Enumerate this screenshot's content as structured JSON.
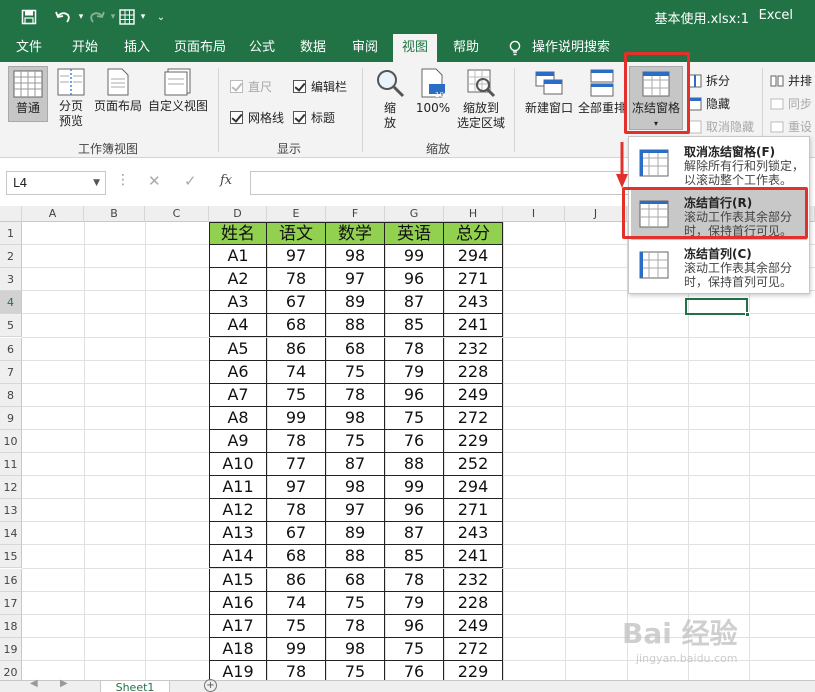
{
  "window": {
    "title": "基本使用.xlsx:1",
    "app_name": "Excel"
  },
  "menu": {
    "tabs": [
      "文件",
      "开始",
      "插入",
      "页面布局",
      "公式",
      "数据",
      "审阅",
      "视图",
      "帮助"
    ],
    "active_tab": "视图",
    "tell_me": "操作说明搜索"
  },
  "ribbon": {
    "workbook_views": {
      "label": "工作簿视图",
      "normal": "普通",
      "page_break_1": "分页",
      "page_break_2": "预览",
      "page_layout": "页面布局",
      "custom_views": "自定义视图"
    },
    "show": {
      "label": "显示",
      "ruler": "直尺",
      "formula_bar": "编辑栏",
      "gridlines": "网格线",
      "headings": "标题"
    },
    "zoom": {
      "label": "缩放",
      "zoom_1": "缩",
      "zoom_2": "放",
      "hundred": "100%",
      "to_selection_1": "缩放到",
      "to_selection_2": "选定区域",
      "badge": "100"
    },
    "window": {
      "new_window": "新建窗口",
      "arrange_all": "全部重排",
      "freeze_panes": "冻结窗格",
      "split": "拆分",
      "hide": "隐藏",
      "unhide": "取消隐藏",
      "side_by_side": "并排",
      "sync": "同步",
      "reset": "重设"
    }
  },
  "formula_bar": {
    "name_box": "L4",
    "fx": "fx"
  },
  "freeze_menu": {
    "items": [
      {
        "title": "取消冻结窗格(F)",
        "desc": "解除所有行和列锁定，以滚动整个工作表。"
      },
      {
        "title": "冻结首行(R)",
        "desc": "滚动工作表其余部分时，保持首行可见。"
      },
      {
        "title": "冻结首列(C)",
        "desc": "滚动工作表其余部分时，保持首列可见。"
      }
    ]
  },
  "sheet": {
    "columns": [
      "A",
      "B",
      "C",
      "D",
      "E",
      "F",
      "G",
      "H",
      "I",
      "J"
    ],
    "rows": [
      "1",
      "2",
      "3",
      "4",
      "5",
      "6",
      "7",
      "8",
      "9",
      "10",
      "11",
      "12",
      "13",
      "14",
      "15",
      "16",
      "17",
      "18",
      "19",
      "20"
    ],
    "headers": [
      "姓名",
      "语文",
      "数学",
      "英语",
      "总分"
    ],
    "data": [
      [
        "A1",
        "97",
        "98",
        "99",
        "294"
      ],
      [
        "A2",
        "78",
        "97",
        "96",
        "271"
      ],
      [
        "A3",
        "67",
        "89",
        "87",
        "243"
      ],
      [
        "A4",
        "68",
        "88",
        "85",
        "241"
      ],
      [
        "A5",
        "86",
        "68",
        "78",
        "232"
      ],
      [
        "A6",
        "74",
        "75",
        "79",
        "228"
      ],
      [
        "A7",
        "75",
        "78",
        "96",
        "249"
      ],
      [
        "A8",
        "99",
        "98",
        "75",
        "272"
      ],
      [
        "A9",
        "78",
        "75",
        "76",
        "229"
      ],
      [
        "A10",
        "77",
        "87",
        "88",
        "252"
      ],
      [
        "A11",
        "97",
        "98",
        "99",
        "294"
      ],
      [
        "A12",
        "78",
        "97",
        "96",
        "271"
      ],
      [
        "A13",
        "67",
        "89",
        "87",
        "243"
      ],
      [
        "A14",
        "68",
        "88",
        "85",
        "241"
      ],
      [
        "A15",
        "86",
        "68",
        "78",
        "232"
      ],
      [
        "A16",
        "74",
        "75",
        "79",
        "228"
      ],
      [
        "A17",
        "75",
        "78",
        "96",
        "249"
      ],
      [
        "A18",
        "99",
        "98",
        "75",
        "272"
      ],
      [
        "A19",
        "78",
        "75",
        "76",
        "229"
      ]
    ],
    "tab_name": "Sheet1"
  },
  "watermark": {
    "text": "Bai 经验",
    "url": "jingyan.baidu.com"
  },
  "colors": {
    "excel_green": "#217346",
    "header_fill": "#92d050",
    "highlight_red": "#e2312d"
  }
}
